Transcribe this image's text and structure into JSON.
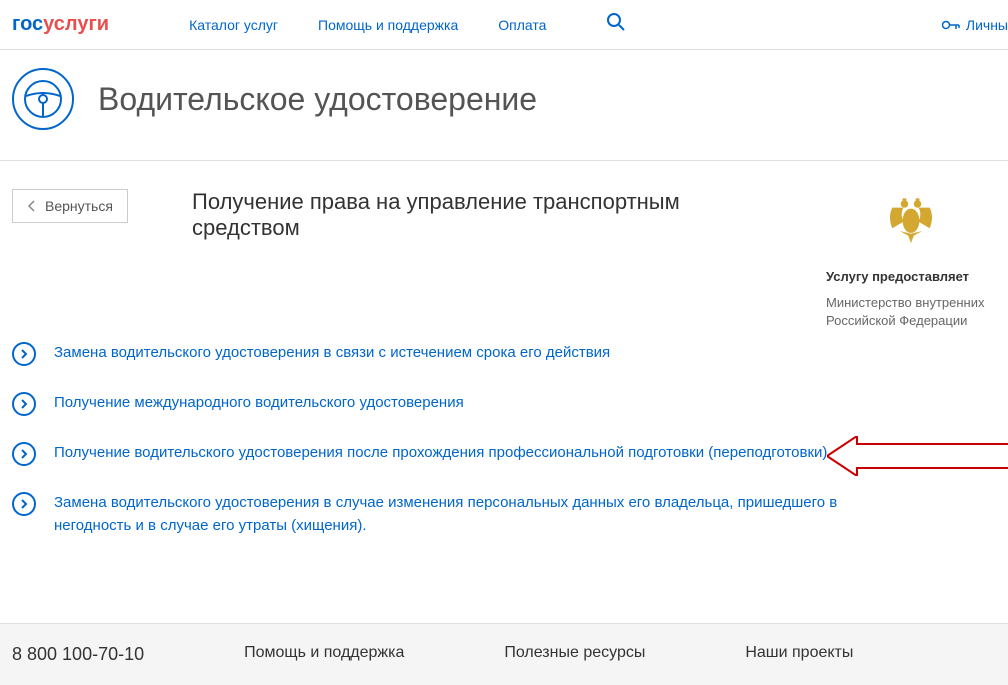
{
  "header": {
    "logo_prefix": "гос",
    "logo_suffix": "услуги",
    "nav": [
      "Каталог услуг",
      "Помощь и поддержка",
      "Оплата"
    ],
    "account": "Личны"
  },
  "page": {
    "title": "Водительское удостоверение",
    "back": "Вернуться",
    "subtitle": "Получение права на управление транспортным средством"
  },
  "provider": {
    "label": "Услугу предоставляет",
    "name": "Министерство внутренних Российской Федерации"
  },
  "services": [
    {
      "label": "Замена водительского удостоверения в связи с истечением срока его действия"
    },
    {
      "label": "Получение международного водительского удостоверения"
    },
    {
      "label": "Получение водительского удостоверения после прохождения профессиональной подготовки (переподготовки)"
    },
    {
      "label": "Замена водительского удостоверения в случае изменения персональных данных его владельца, пришедшего в негодность и в случае его утраты (хищения)."
    }
  ],
  "footer": {
    "phone": "8 800 100-70-10",
    "col1": "Помощь и поддержка",
    "col2": "Полезные ресурсы",
    "col3": "Наши проекты"
  }
}
